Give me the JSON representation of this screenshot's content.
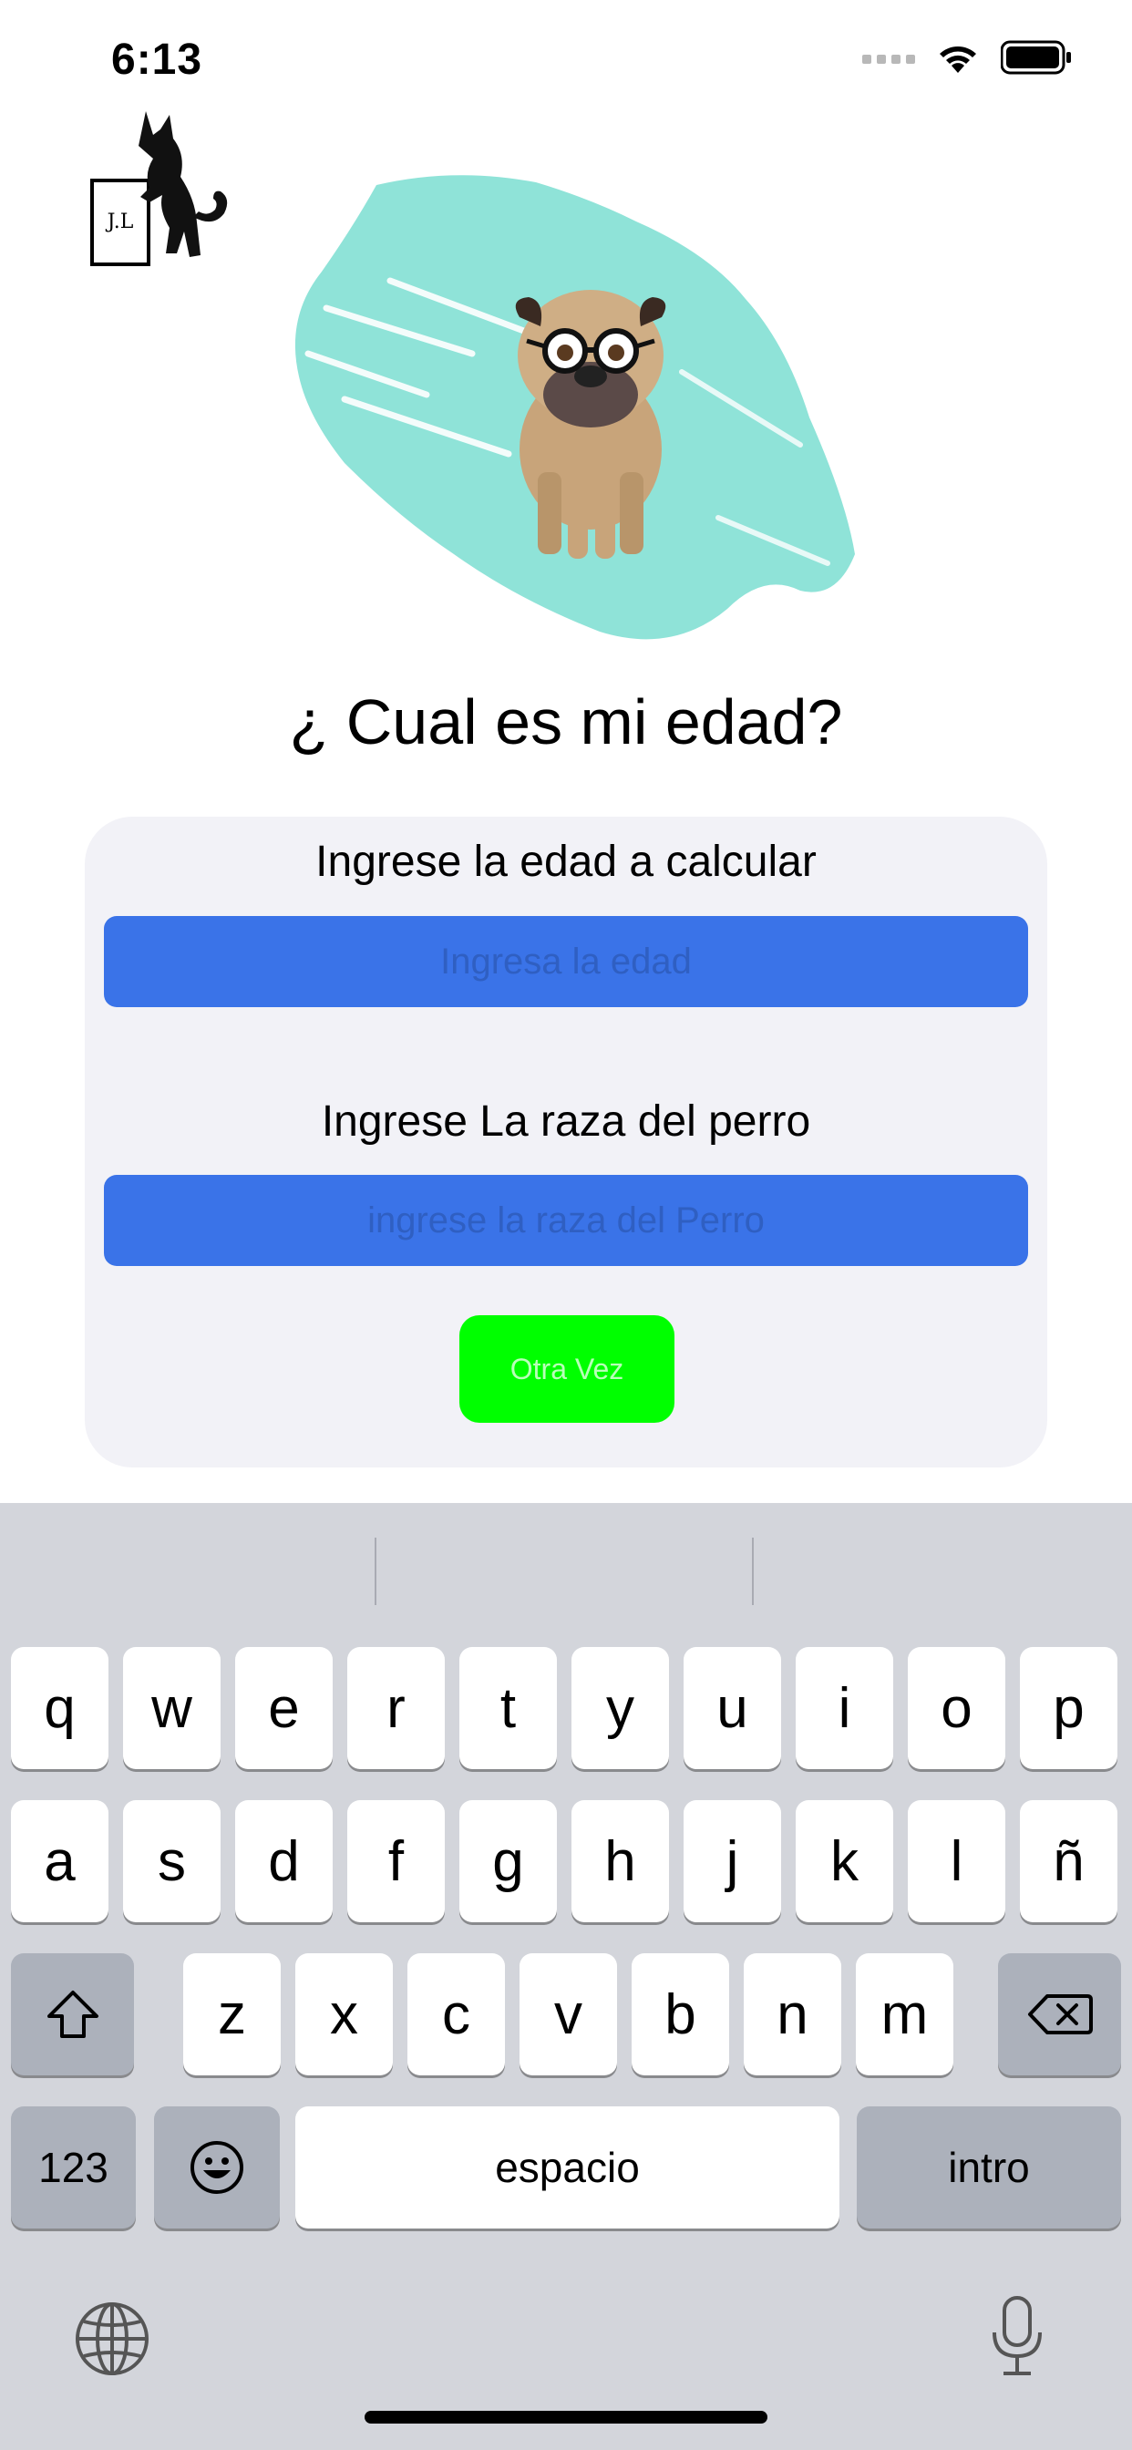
{
  "status_bar": {
    "time": "6:13"
  },
  "logo": {
    "initials": "J.L"
  },
  "title": "¿ Cual es mi edad?",
  "form": {
    "age_label": "Ingrese la edad a calcular",
    "age_placeholder": "Ingresa la edad",
    "breed_label": "Ingrese La raza del perro",
    "breed_placeholder": "ingrese la raza del Perro",
    "retry_button": "Otra Vez"
  },
  "colors": {
    "input_bg": "#3a73e8",
    "button_bg": "#00ff00",
    "card_bg": "#f2f2f7",
    "hero_splash": "#8fe3d8"
  },
  "keyboard": {
    "row1": [
      "q",
      "w",
      "e",
      "r",
      "t",
      "y",
      "u",
      "i",
      "o",
      "p"
    ],
    "row2": [
      "a",
      "s",
      "d",
      "f",
      "g",
      "h",
      "j",
      "k",
      "l",
      "ñ"
    ],
    "row3": [
      "z",
      "x",
      "c",
      "v",
      "b",
      "n",
      "m"
    ],
    "numbers_key": "123",
    "space_key": "espacio",
    "return_key": "intro",
    "icons": [
      "shift-icon",
      "delete-icon",
      "emoji-icon",
      "globe-icon",
      "microphone-icon"
    ]
  }
}
